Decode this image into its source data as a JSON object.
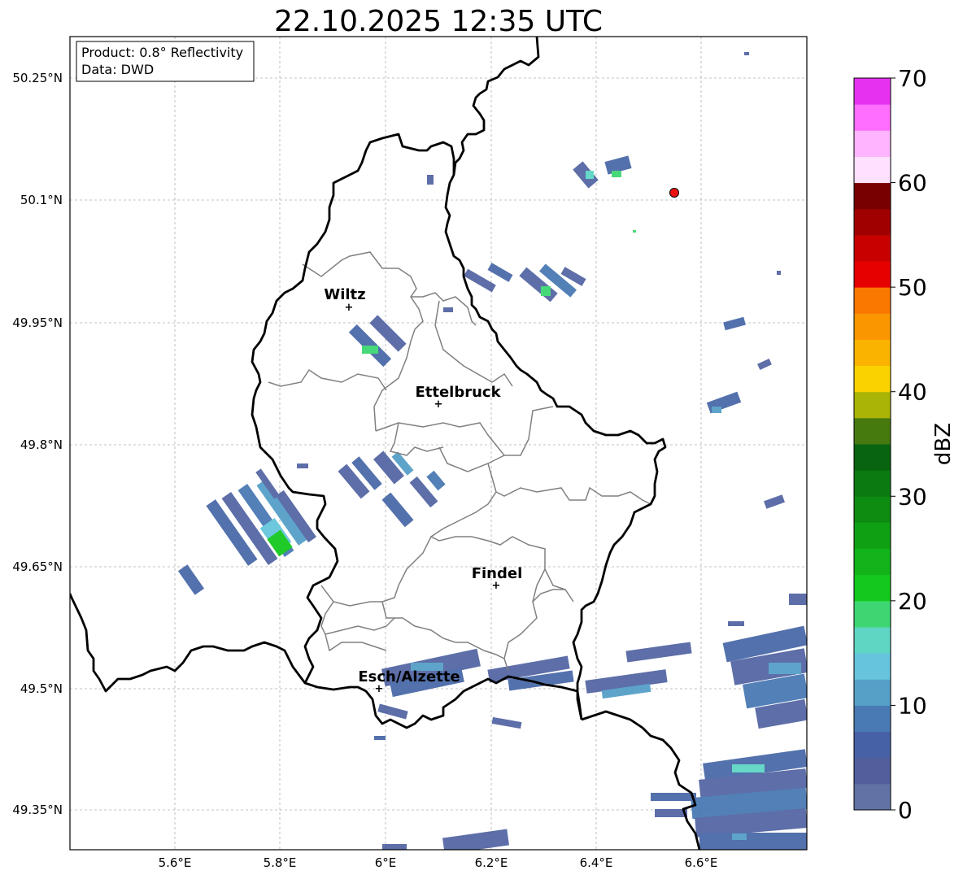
{
  "title": "22.10.2025 12:35 UTC",
  "info_box": {
    "line1": "Product: 0.8° Reflectivity",
    "line2": "Data: DWD"
  },
  "lat_labels": [
    "50.25°N",
    "50.1°N",
    "49.95°N",
    "49.8°N",
    "49.65°N",
    "49.5°N",
    "49.35°N"
  ],
  "lon_labels": [
    "5.6°E",
    "5.8°E",
    "6°E",
    "6.2°E",
    "6.4°E",
    "6.6°E"
  ],
  "cities": [
    {
      "name": "Wiltz"
    },
    {
      "name": "Ettelbruck"
    },
    {
      "name": "Findel"
    },
    {
      "name": "Esch/Alzette"
    }
  ],
  "colorbar": {
    "label": "dBZ",
    "ticks": [
      "0",
      "10",
      "20",
      "30",
      "40",
      "50",
      "60",
      "70"
    ],
    "colors": [
      "#6272a4",
      "#525f9c",
      "#4661a6",
      "#4a7ab4",
      "#56a0c8",
      "#66c4dc",
      "#5fd6c4",
      "#3ed672",
      "#14c81e",
      "#12b41a",
      "#10a014",
      "#0e8c12",
      "#0b7a10",
      "#086410",
      "#467a0e",
      "#aab406",
      "#fad200",
      "#fab400",
      "#fa9600",
      "#fa7800",
      "#e60000",
      "#c80000",
      "#a00000",
      "#780000",
      "#ffe0ff",
      "#ffb4ff",
      "#ff6eff",
      "#e632f0"
    ]
  },
  "radar_marker_color": "#ee1111"
}
